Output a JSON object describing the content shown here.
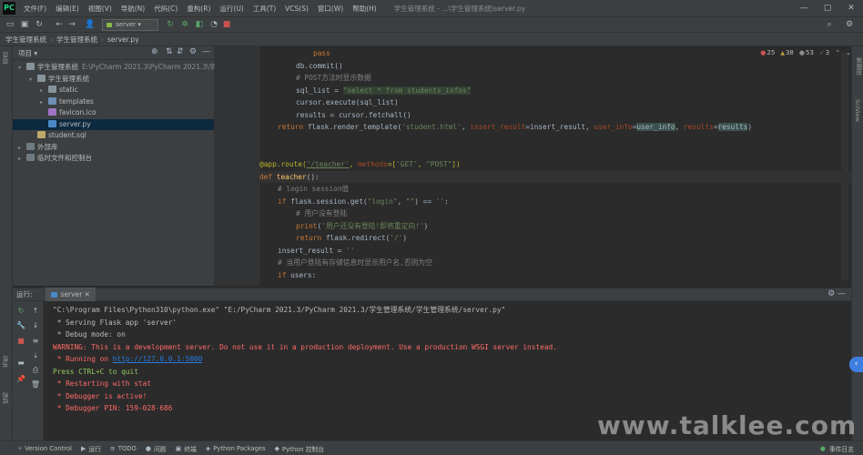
{
  "app": {
    "logo": "PC",
    "window_title": "学生管理系统 - ...\\学生管理系统\\server.py"
  },
  "menu": [
    "文件(F)",
    "编辑(E)",
    "视图(V)",
    "导航(N)",
    "代码(C)",
    "重构(R)",
    "运行(U)",
    "工具(T)",
    "VCS(S)",
    "窗口(W)",
    "帮助(H)"
  ],
  "window_controls": {
    "minimize": "—",
    "maximize": "▢",
    "close": "✕"
  },
  "toolbar": {
    "run_config": "server"
  },
  "breadcrumb": [
    "学生管理系统",
    "学生管理系统",
    "server.py"
  ],
  "project_panel": {
    "title": "项目",
    "tree": [
      {
        "label": "学生管理系统",
        "path": "E:\\PyCharm 2021.3\\PyCharm 2021.3\\学生管",
        "arrow": "▾",
        "type": "folder"
      },
      {
        "label": "学生管理系统",
        "path": "",
        "arrow": "▾",
        "type": "folder"
      },
      {
        "label": "static",
        "path": "",
        "arrow": "▸",
        "type": "folder"
      },
      {
        "label": "templates",
        "path": "",
        "arrow": "▸",
        "type": "folder-blue"
      },
      {
        "label": "favicon.ico",
        "path": "",
        "arrow": "",
        "type": "ico"
      },
      {
        "label": "server.py",
        "path": "",
        "arrow": "",
        "type": "py"
      },
      {
        "label": "student.sql",
        "path": "",
        "arrow": "",
        "type": "sql"
      },
      {
        "label": "外部库",
        "path": "",
        "arrow": "▸",
        "type": "lib"
      },
      {
        "label": "临时文件和控制台",
        "path": "",
        "arrow": "▸",
        "type": "lib"
      }
    ]
  },
  "left_strip_labels": [
    "项目",
    "书签",
    "结构"
  ],
  "right_strip_labels": [
    "数据库",
    "SciView"
  ],
  "inspections": {
    "errors": "25",
    "warnings": "38",
    "weak": "53",
    "typos": "3"
  },
  "run_panel": {
    "label": "运行:",
    "tab": "server"
  },
  "console_lines": [
    {
      "text": "\"C:\\Program Files\\Python310\\python.exe\" \"E:/PyCharm 2021.3/PyCharm 2021.3/学生管理系统/学生管理系统/server.py\"",
      "kind": "def"
    },
    {
      "text": " * Serving Flask app 'server'",
      "kind": "def"
    },
    {
      "text": " * Debug mode: on",
      "kind": "def"
    },
    {
      "text": "WARNING: This is a development server. Do not use it in a production deployment. Use a production WSGI server instead.",
      "kind": "red"
    },
    {
      "text": " * Running on ",
      "kind": "red",
      "link": "http://127.0.0.1:5000"
    },
    {
      "text": "Press CTRL+C to quit",
      "kind": "grn"
    },
    {
      "text": " * Restarting with stat",
      "kind": "red"
    },
    {
      "text": " * Debugger is active!",
      "kind": "red"
    },
    {
      "text": " * Debugger PIN: 159-028-686",
      "kind": "red"
    }
  ],
  "status_bar": {
    "items": [
      "Version Control",
      "运行",
      "TODO",
      "问题",
      "终端",
      "Python Packages",
      "Python 控制台"
    ],
    "event_log": "事件日志"
  },
  "watermark": "www.talklee.com"
}
